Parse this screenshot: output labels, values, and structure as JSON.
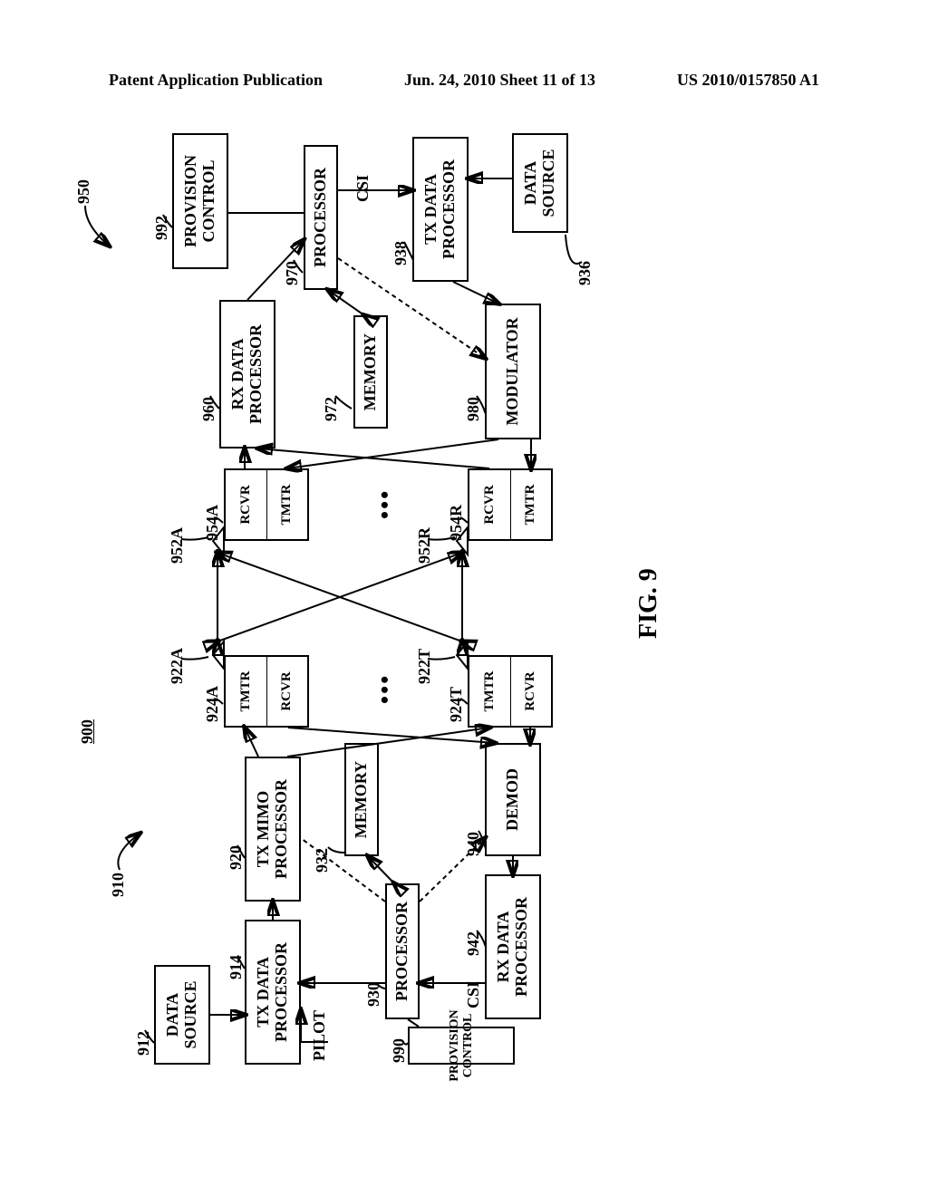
{
  "header": {
    "left": "Patent Application Publication",
    "center": "Jun. 24, 2010  Sheet 11 of 13",
    "right": "US 2010/0157850 A1"
  },
  "figure_label": "FIG. 9",
  "system_ref": "900",
  "left_side": {
    "leader": "910",
    "data_source_ref": "912",
    "data_source": "DATA\nSOURCE",
    "tx_data_processor_ref": "914",
    "tx_data_processor": "TX DATA\nPROCESSOR",
    "pilot": "PILOT",
    "tx_mimo_ref": "920",
    "tx_mimo": "TX MIMO\nPROCESSOR",
    "processor_ref": "930",
    "processor": "PROCESSOR",
    "memory_ref": "932",
    "memory": "MEMORY",
    "provision_ref": "990",
    "provision": "PROVISION\nCONTROL",
    "rx_data_processor_ref": "942",
    "rx_data_processor": "RX DATA\nPROCESSOR",
    "csi": "CSI",
    "demod_ref": "940",
    "demod": "DEMOD",
    "txrx_top_ref": "924A",
    "ant_top_ref": "922A",
    "txrx_bot_ref": "924T",
    "ant_bot_ref": "922T",
    "tmtr": "TMTR",
    "rcvr": "RCVR"
  },
  "right_side": {
    "leader": "950",
    "rx_data_processor_ref": "960",
    "rx_data_processor": "RX DATA\nPROCESSOR",
    "provision_ref": "992",
    "provision": "PROVISION\nCONTROL",
    "processor_ref": "970",
    "processor": "PROCESSOR",
    "memory_ref": "972",
    "memory": "MEMORY",
    "tx_data_processor_ref": "938",
    "tx_data_processor": "TX DATA\nPROCESSOR",
    "csi": "CSI",
    "modulator_ref": "980",
    "modulator": "MODULATOR",
    "data_source_ref": "936",
    "data_source": "DATA\nSOURCE",
    "txrx_top_ref": "954A",
    "ant_top_ref": "952A",
    "txrx_bot_ref": "954R",
    "ant_bot_ref": "952R",
    "rcvr": "RCVR",
    "tmtr": "TMTR"
  }
}
